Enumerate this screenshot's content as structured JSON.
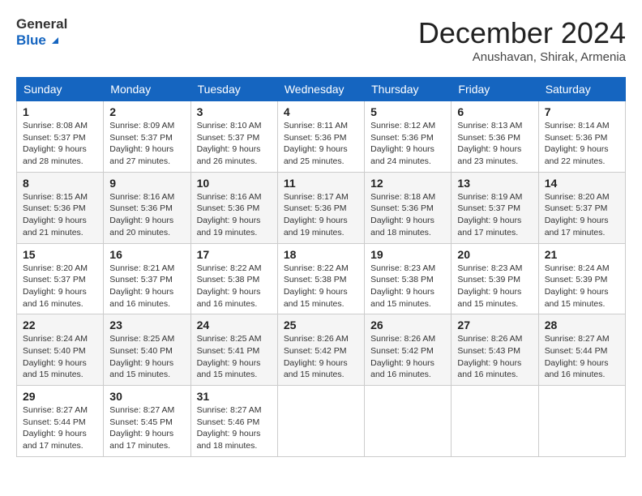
{
  "header": {
    "logo_line1": "General",
    "logo_line2": "Blue",
    "month_title": "December 2024",
    "location": "Anushavan, Shirak, Armenia"
  },
  "weekdays": [
    "Sunday",
    "Monday",
    "Tuesday",
    "Wednesday",
    "Thursday",
    "Friday",
    "Saturday"
  ],
  "weeks": [
    [
      {
        "day": "1",
        "sunrise": "8:08 AM",
        "sunset": "5:37 PM",
        "daylight": "9 hours and 28 minutes"
      },
      {
        "day": "2",
        "sunrise": "8:09 AM",
        "sunset": "5:37 PM",
        "daylight": "9 hours and 27 minutes"
      },
      {
        "day": "3",
        "sunrise": "8:10 AM",
        "sunset": "5:37 PM",
        "daylight": "9 hours and 26 minutes"
      },
      {
        "day": "4",
        "sunrise": "8:11 AM",
        "sunset": "5:36 PM",
        "daylight": "9 hours and 25 minutes"
      },
      {
        "day": "5",
        "sunrise": "8:12 AM",
        "sunset": "5:36 PM",
        "daylight": "9 hours and 24 minutes"
      },
      {
        "day": "6",
        "sunrise": "8:13 AM",
        "sunset": "5:36 PM",
        "daylight": "9 hours and 23 minutes"
      },
      {
        "day": "7",
        "sunrise": "8:14 AM",
        "sunset": "5:36 PM",
        "daylight": "9 hours and 22 minutes"
      }
    ],
    [
      {
        "day": "8",
        "sunrise": "8:15 AM",
        "sunset": "5:36 PM",
        "daylight": "9 hours and 21 minutes"
      },
      {
        "day": "9",
        "sunrise": "8:16 AM",
        "sunset": "5:36 PM",
        "daylight": "9 hours and 20 minutes"
      },
      {
        "day": "10",
        "sunrise": "8:16 AM",
        "sunset": "5:36 PM",
        "daylight": "9 hours and 19 minutes"
      },
      {
        "day": "11",
        "sunrise": "8:17 AM",
        "sunset": "5:36 PM",
        "daylight": "9 hours and 19 minutes"
      },
      {
        "day": "12",
        "sunrise": "8:18 AM",
        "sunset": "5:36 PM",
        "daylight": "9 hours and 18 minutes"
      },
      {
        "day": "13",
        "sunrise": "8:19 AM",
        "sunset": "5:37 PM",
        "daylight": "9 hours and 17 minutes"
      },
      {
        "day": "14",
        "sunrise": "8:20 AM",
        "sunset": "5:37 PM",
        "daylight": "9 hours and 17 minutes"
      }
    ],
    [
      {
        "day": "15",
        "sunrise": "8:20 AM",
        "sunset": "5:37 PM",
        "daylight": "9 hours and 16 minutes"
      },
      {
        "day": "16",
        "sunrise": "8:21 AM",
        "sunset": "5:37 PM",
        "daylight": "9 hours and 16 minutes"
      },
      {
        "day": "17",
        "sunrise": "8:22 AM",
        "sunset": "5:38 PM",
        "daylight": "9 hours and 16 minutes"
      },
      {
        "day": "18",
        "sunrise": "8:22 AM",
        "sunset": "5:38 PM",
        "daylight": "9 hours and 15 minutes"
      },
      {
        "day": "19",
        "sunrise": "8:23 AM",
        "sunset": "5:38 PM",
        "daylight": "9 hours and 15 minutes"
      },
      {
        "day": "20",
        "sunrise": "8:23 AM",
        "sunset": "5:39 PM",
        "daylight": "9 hours and 15 minutes"
      },
      {
        "day": "21",
        "sunrise": "8:24 AM",
        "sunset": "5:39 PM",
        "daylight": "9 hours and 15 minutes"
      }
    ],
    [
      {
        "day": "22",
        "sunrise": "8:24 AM",
        "sunset": "5:40 PM",
        "daylight": "9 hours and 15 minutes"
      },
      {
        "day": "23",
        "sunrise": "8:25 AM",
        "sunset": "5:40 PM",
        "daylight": "9 hours and 15 minutes"
      },
      {
        "day": "24",
        "sunrise": "8:25 AM",
        "sunset": "5:41 PM",
        "daylight": "9 hours and 15 minutes"
      },
      {
        "day": "25",
        "sunrise": "8:26 AM",
        "sunset": "5:42 PM",
        "daylight": "9 hours and 15 minutes"
      },
      {
        "day": "26",
        "sunrise": "8:26 AM",
        "sunset": "5:42 PM",
        "daylight": "9 hours and 16 minutes"
      },
      {
        "day": "27",
        "sunrise": "8:26 AM",
        "sunset": "5:43 PM",
        "daylight": "9 hours and 16 minutes"
      },
      {
        "day": "28",
        "sunrise": "8:27 AM",
        "sunset": "5:44 PM",
        "daylight": "9 hours and 16 minutes"
      }
    ],
    [
      {
        "day": "29",
        "sunrise": "8:27 AM",
        "sunset": "5:44 PM",
        "daylight": "9 hours and 17 minutes"
      },
      {
        "day": "30",
        "sunrise": "8:27 AM",
        "sunset": "5:45 PM",
        "daylight": "9 hours and 17 minutes"
      },
      {
        "day": "31",
        "sunrise": "8:27 AM",
        "sunset": "5:46 PM",
        "daylight": "9 hours and 18 minutes"
      },
      null,
      null,
      null,
      null
    ]
  ]
}
